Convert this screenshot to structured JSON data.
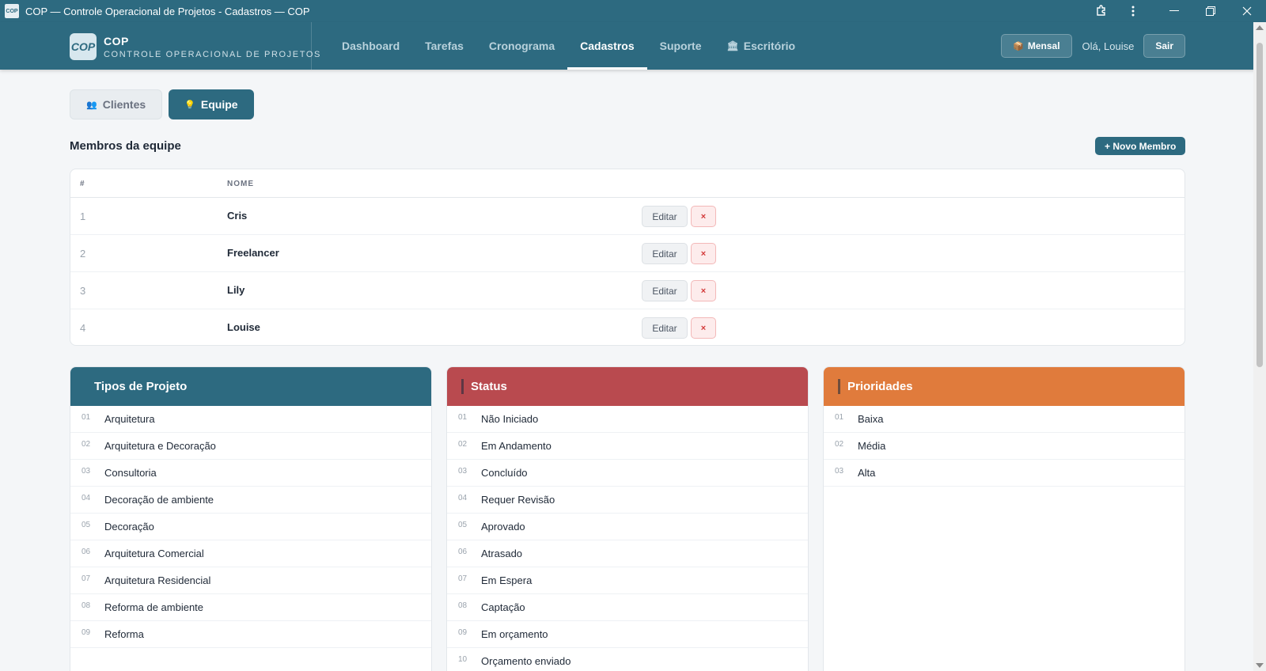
{
  "window": {
    "app_icon_text": "COP",
    "title": "COP — Controle Operacional de Projetos - Cadastros — COP"
  },
  "brand": {
    "logo": "COP",
    "name": "COP",
    "subtitle": "CONTROLE OPERACIONAL DE PROJETOS"
  },
  "nav": {
    "items": [
      {
        "label": "Dashboard",
        "active": false
      },
      {
        "label": "Tarefas",
        "active": false
      },
      {
        "label": "Cronograma",
        "active": false
      },
      {
        "label": "Cadastros",
        "active": true
      },
      {
        "label": "Suporte",
        "active": false
      },
      {
        "label": "Escritório",
        "active": false,
        "icon": "bank-icon"
      }
    ]
  },
  "header": {
    "plan_label": "Mensal",
    "plan_icon": "package-icon",
    "greeting": "Olá, Louise",
    "logout_label": "Sair"
  },
  "subtabs": [
    {
      "label": "Clientes",
      "icon": "people-icon",
      "active": false
    },
    {
      "label": "Equipe",
      "icon": "person-icon",
      "active": true
    }
  ],
  "team": {
    "title": "Membros da equipe",
    "new_button": "+ Novo Membro",
    "columns": [
      "#",
      "NOME"
    ],
    "rows": [
      {
        "num": "1",
        "name": "Cris"
      },
      {
        "num": "2",
        "name": "Freelancer"
      },
      {
        "num": "3",
        "name": "Lily"
      },
      {
        "num": "4",
        "name": "Louise"
      }
    ],
    "edit_label": "Editar",
    "delete_label": "×"
  },
  "cards": [
    {
      "title": "Tipos de Projeto",
      "color": "#2d6a80",
      "items": [
        {
          "ix": "01",
          "label": "Arquitetura"
        },
        {
          "ix": "02",
          "label": "Arquitetura e Decoração"
        },
        {
          "ix": "03",
          "label": "Consultoria"
        },
        {
          "ix": "04",
          "label": "Decoração de ambiente"
        },
        {
          "ix": "05",
          "label": "Decoração"
        },
        {
          "ix": "06",
          "label": "Arquitetura Comercial"
        },
        {
          "ix": "07",
          "label": "Arquitetura Residencial"
        },
        {
          "ix": "08",
          "label": "Reforma de ambiente"
        },
        {
          "ix": "09",
          "label": "Reforma"
        }
      ]
    },
    {
      "title": "Status",
      "color": "#b94a4f",
      "items": [
        {
          "ix": "01",
          "label": "Não Iniciado"
        },
        {
          "ix": "02",
          "label": "Em Andamento"
        },
        {
          "ix": "03",
          "label": "Concluído"
        },
        {
          "ix": "04",
          "label": "Requer Revisão"
        },
        {
          "ix": "05",
          "label": "Aprovado"
        },
        {
          "ix": "06",
          "label": "Atrasado"
        },
        {
          "ix": "07",
          "label": "Em Espera"
        },
        {
          "ix": "08",
          "label": "Captação"
        },
        {
          "ix": "09",
          "label": "Em orçamento"
        },
        {
          "ix": "10",
          "label": "Orçamento enviado"
        }
      ]
    },
    {
      "title": "Prioridades",
      "color": "#e07b3c",
      "items": [
        {
          "ix": "01",
          "label": "Baixa"
        },
        {
          "ix": "02",
          "label": "Média"
        },
        {
          "ix": "03",
          "label": "Alta"
        }
      ]
    }
  ]
}
